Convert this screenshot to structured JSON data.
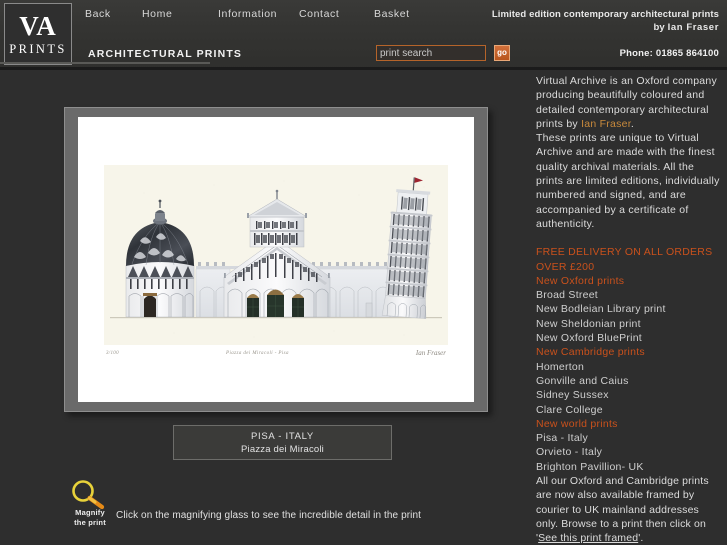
{
  "header": {
    "logo_line1": "VA",
    "logo_line2": "PRINTS",
    "section_title": "ARCHITECTURAL PRINTS",
    "tagline_line1": "Limited edition contemporary architectural prints",
    "tagline_by": "by",
    "tagline_name": "Ian  Fraser",
    "phone": "Phone: 01865 864100",
    "nav": [
      {
        "label": "Back"
      },
      {
        "label": "Home"
      },
      {
        "label": "Information"
      },
      {
        "label": "Contact"
      },
      {
        "label": "Basket"
      }
    ],
    "search": {
      "placeholder": "print search",
      "value": "",
      "go_label": "go"
    }
  },
  "print": {
    "inscription_edition": "3/100",
    "inscription_title": "Piazza dei Miracoli - Pisa",
    "inscription_signature": "Ian Fraser",
    "caption_title": "PISA - ITALY",
    "caption_subtitle": "Piazza dei Miracoli",
    "artwork_alt": "Piazza dei Miracoli, Pisa - Baptistery, Cathedral and Leaning Tower"
  },
  "magnify": {
    "label_line1": "Magnify",
    "label_line2": "the print",
    "hint": "Click on the magnifying glass to see the incredible detail in the print"
  },
  "sidebar": {
    "intro_p1_before": "Virtual Archive is an Oxford company producing beautifully coloured and detailed contemporary architectural prints by ",
    "intro_artist": "Ian Fraser",
    "intro_p1_after": ".",
    "intro_p2": "These prints are unique to Virtual Archive and are made with the finest quality archival materials. All the prints are limited editions, individually numbered and signed, and are accompanied by a certificate of authenticity.",
    "links": [
      {
        "label": "FREE DELIVERY ON ALL ORDERS",
        "style": "hdr"
      },
      {
        "label": "OVER £200",
        "style": "hdr"
      },
      {
        "label": "New Oxford prints",
        "style": "cat"
      },
      {
        "label": "Broad Street",
        "style": "item"
      },
      {
        "label": "New Bodleian Library print",
        "style": "item"
      },
      {
        "label": "New Sheldonian print",
        "style": "item"
      },
      {
        "label": "New Oxford BluePrint",
        "style": "item"
      },
      {
        "label": "New Cambridge prints",
        "style": "cat"
      },
      {
        "label": "Homerton",
        "style": "item"
      },
      {
        "label": "Gonville and Caius",
        "style": "item"
      },
      {
        "label": "Sidney Sussex",
        "style": "item"
      },
      {
        "label": "Clare College",
        "style": "item"
      },
      {
        "label": "New world prints",
        "style": "cat"
      },
      {
        "label": "Pisa - Italy",
        "style": "item"
      },
      {
        "label": "Orvieto - Italy",
        "style": "item"
      },
      {
        "label": "Brighton Pavillion- UK",
        "style": "item"
      }
    ],
    "delivery_note_part1": "All our Oxford and Cambridge prints are now also available framed by courier to UK mainland addresses only. Browse to a print then click on '",
    "delivery_note_link": "See this print framed",
    "delivery_note_part2": "'."
  },
  "colors": {
    "page_background": "#2e2e2e",
    "header_background": "#353533",
    "accent_orange": "#c9511c",
    "artist_gold": "#c98a3c",
    "frame_gray": "#6a6a6a",
    "mount_white": "#ffffff",
    "paper_cream": "#f7f5ea",
    "flag_red": "#9e2430"
  }
}
